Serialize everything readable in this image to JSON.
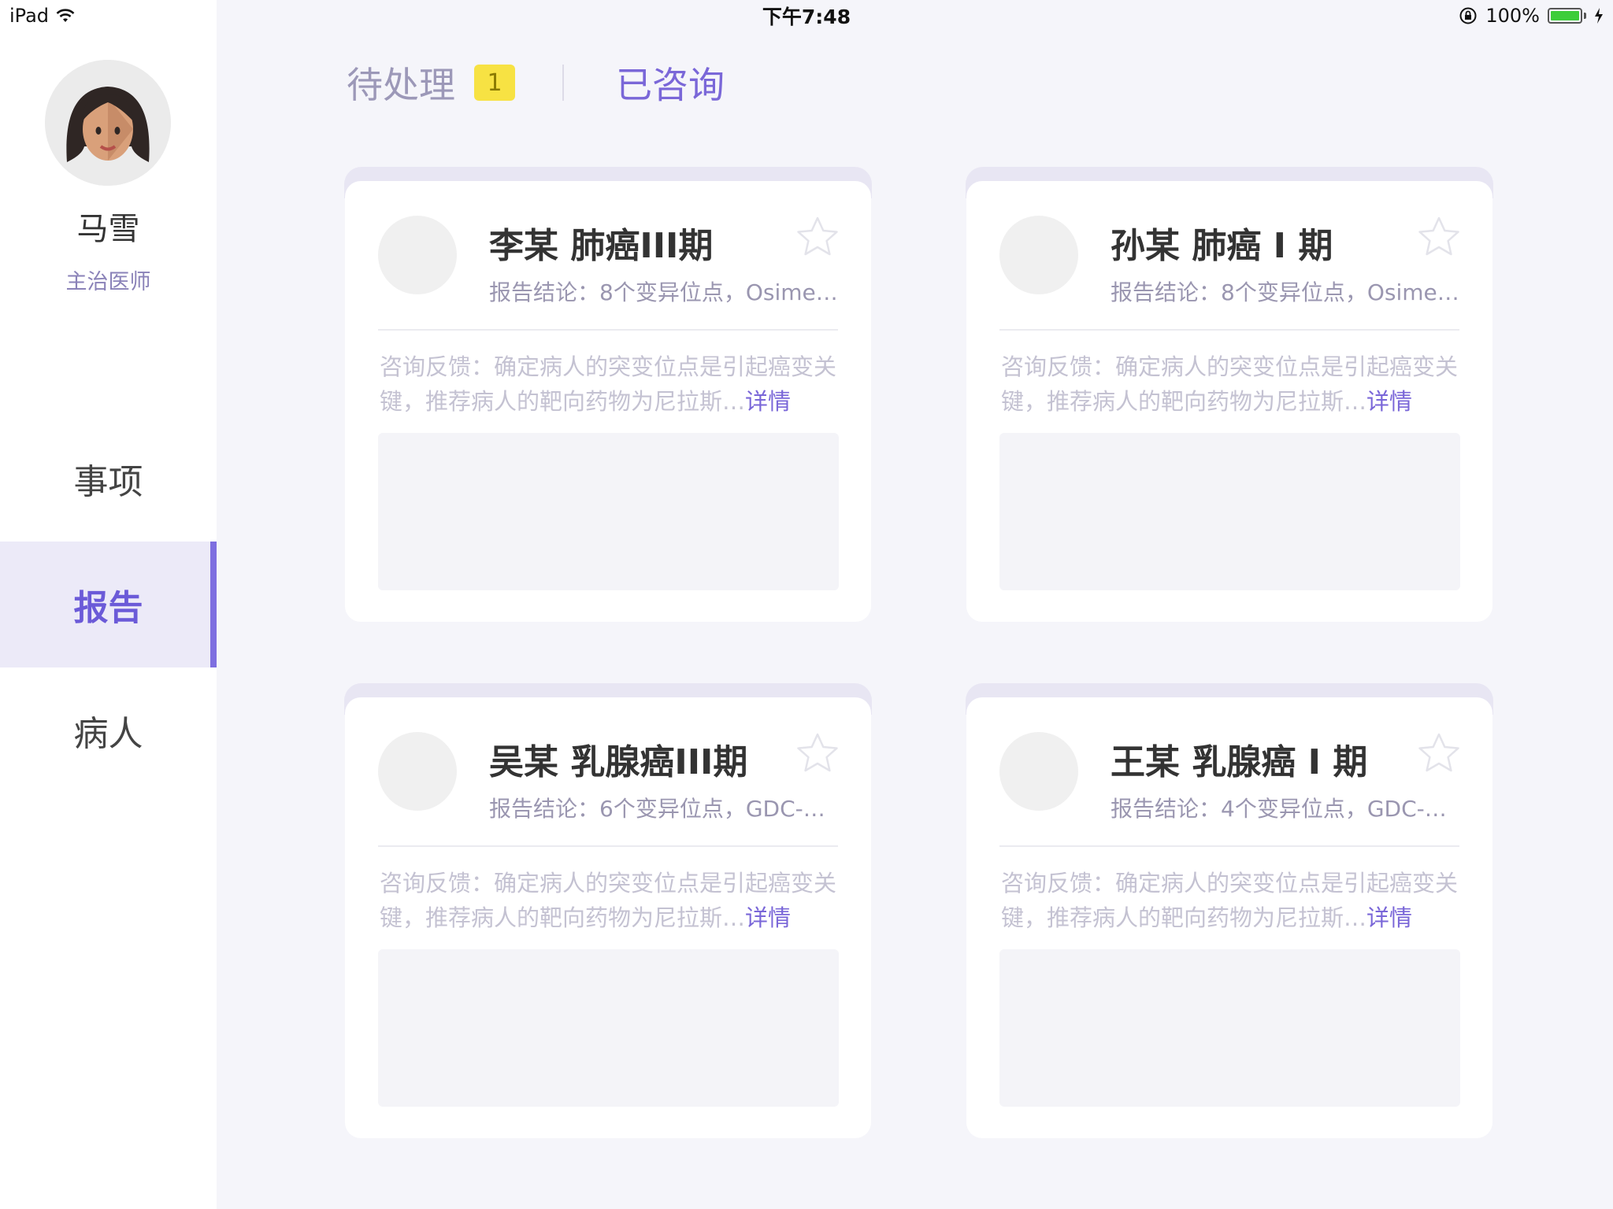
{
  "status": {
    "device": "iPad",
    "time": "下午7:48",
    "battery": "100%"
  },
  "sidebar": {
    "user_name": "马雪",
    "user_role": "主治医师",
    "nav": [
      {
        "label": "事项",
        "active": false
      },
      {
        "label": "报告",
        "active": true
      },
      {
        "label": "病人",
        "active": false
      }
    ]
  },
  "tabs": {
    "pending_label": "待处理",
    "pending_count": "1",
    "consulted_label": "已咨询"
  },
  "cards": [
    {
      "title": "李某 肺癌III期",
      "conclusion": "报告结论：8个变异位点，Osime…",
      "feedback": "咨询反馈：确定病人的突变位点是引起癌变关键，推荐病人的靶向药物为尼拉斯…",
      "detail": "详情"
    },
    {
      "title": "孙某 肺癌 I 期",
      "conclusion": "报告结论：8个变异位点，Osime…",
      "feedback": "咨询反馈：确定病人的突变位点是引起癌变关键，推荐病人的靶向药物为尼拉斯…",
      "detail": "详情"
    },
    {
      "title": "吴某 乳腺癌III期",
      "conclusion": "报告结论：6个变异位点，GDC-…",
      "feedback": "咨询反馈：确定病人的突变位点是引起癌变关键，推荐病人的靶向药物为尼拉斯…",
      "detail": "详情"
    },
    {
      "title": "王某 乳腺癌 I 期",
      "conclusion": "报告结论：4个变异位点，GDC-…",
      "feedback": "咨询反馈：确定病人的突变位点是引起癌变关键，推荐病人的靶向药物为尼拉斯…",
      "detail": "详情"
    }
  ],
  "colors": {
    "accent": "#7a67d8",
    "badge": "#f7e243",
    "active_nav_bg": "#eceaf8"
  }
}
